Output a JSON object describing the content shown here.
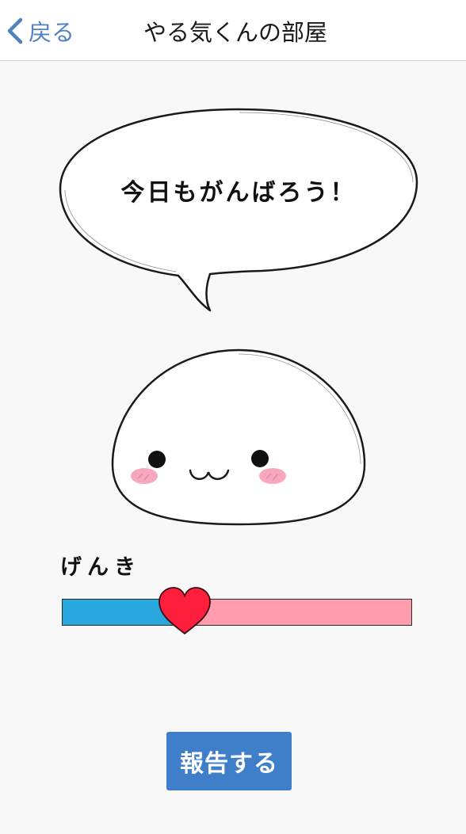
{
  "navbar": {
    "back_label": "戻る",
    "title": "やる気くんの部屋"
  },
  "bubble": {
    "message": "今日もがんばろう！"
  },
  "genki": {
    "label": "げんき",
    "level": 0.35
  },
  "report_button": {
    "label": "報告する"
  },
  "colors": {
    "accent": "#4f82bf",
    "button": "#3f7fc9",
    "meter_fill": "#29a8e0",
    "meter_track": "#ff9cad",
    "heart": "#ff1f3d",
    "cheek": "#f7a8bf"
  },
  "icons": {
    "back": "chevron-left-icon",
    "meter_handle": "heart-icon"
  }
}
